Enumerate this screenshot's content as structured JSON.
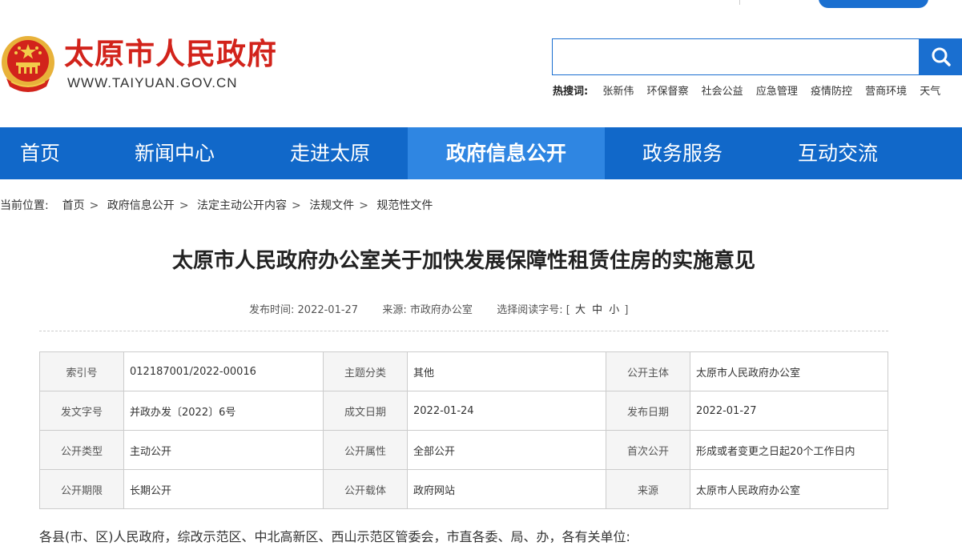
{
  "header": {
    "site_title": "太原市人民政府",
    "site_url": "WWW.TAIYUAN.GOV.CN"
  },
  "search": {
    "value": "",
    "placeholder": "",
    "hot_label": "热搜词:",
    "hot_words": [
      "张新伟",
      "环保督察",
      "社会公益",
      "应急管理",
      "疫情防控",
      "营商环境",
      "天气"
    ]
  },
  "nav": {
    "items": [
      "首页",
      "新闻中心",
      "走进太原",
      "政府信息公开",
      "政务服务",
      "互动交流"
    ],
    "active": "政府信息公开"
  },
  "breadcrumb": {
    "label": "当前位置:",
    "items": [
      "首页",
      "政府信息公开",
      "法定主动公开内容",
      "法规文件",
      "规范性文件"
    ]
  },
  "article": {
    "title": "太原市人民政府办公室关于加快发展保障性租赁住房的实施意见",
    "meta": {
      "publish_label": "发布时间:",
      "publish_date": "2022-01-27",
      "source_label": "来源:",
      "source": "市政府办公室",
      "fontsize_label": "选择阅读字号:",
      "bracket_open": "[",
      "bracket_close": "]",
      "sizes": [
        "大",
        "中",
        "小"
      ]
    },
    "info_table": [
      [
        {
          "k": "索引号",
          "v": "012187001/2022-00016"
        },
        {
          "k": "主题分类",
          "v": "其他"
        },
        {
          "k": "公开主体",
          "v": "太原市人民政府办公室"
        }
      ],
      [
        {
          "k": "发文字号",
          "v": "并政办发〔2022〕6号"
        },
        {
          "k": "成文日期",
          "v": "2022-01-24"
        },
        {
          "k": "发布日期",
          "v": "2022-01-27"
        }
      ],
      [
        {
          "k": "公开类型",
          "v": "主动公开"
        },
        {
          "k": "公开属性",
          "v": "全部公开"
        },
        {
          "k": "首次公开",
          "v": "形成或者变更之日起20个工作日内"
        }
      ],
      [
        {
          "k": "公开期限",
          "v": "长期公开"
        },
        {
          "k": "公开载体",
          "v": "政府网站"
        },
        {
          "k": "来源",
          "v": "太原市人民政府办公室"
        }
      ]
    ],
    "body_first_line": "各县(市、区)人民政府，综改示范区、中北高新区、西山示范区管委会，市直各委、局、办，各有关单位:"
  },
  "colors": {
    "brand_red": "#d2231b",
    "nav_blue": "#1168c9",
    "nav_active": "#2f86e2"
  }
}
